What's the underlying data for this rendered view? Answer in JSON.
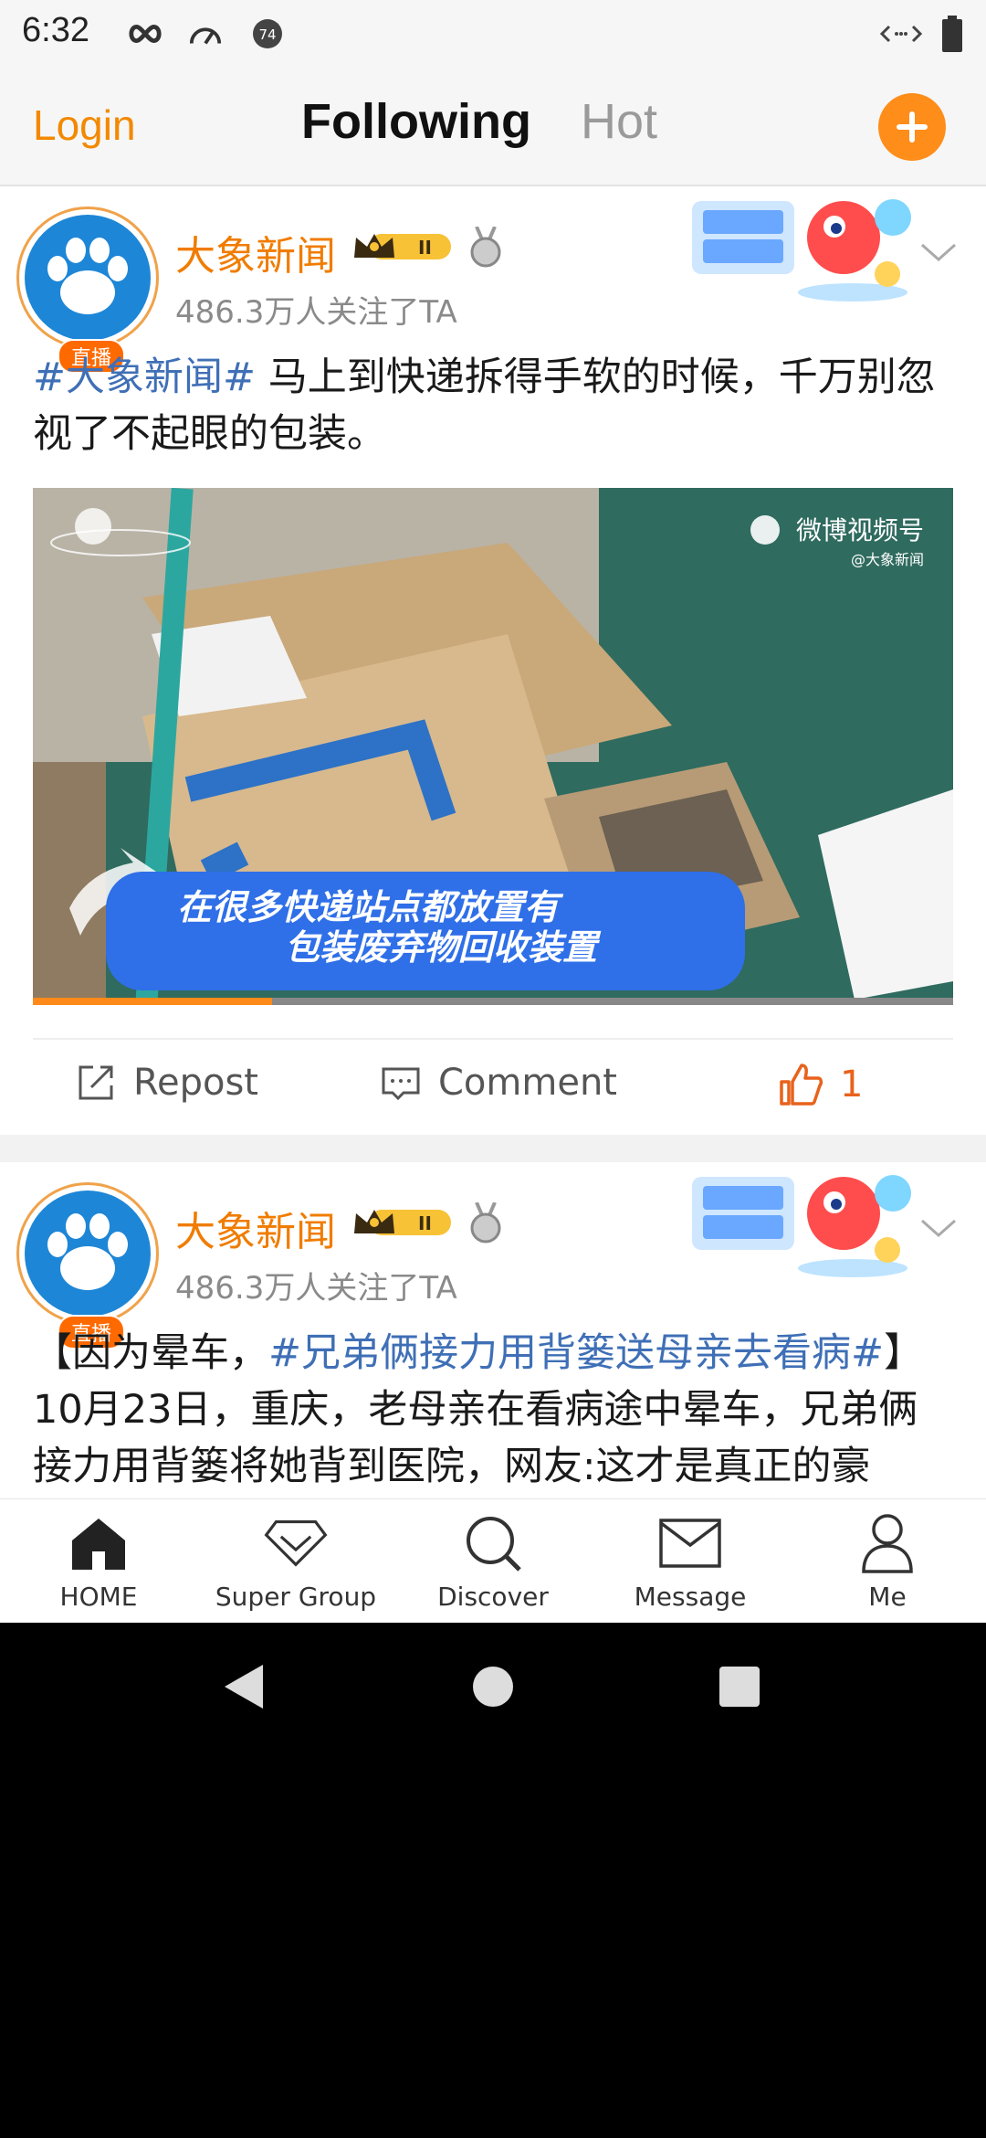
{
  "status_bar": {
    "time": "6:32",
    "icons": [
      "infinity-icon",
      "speedometer-icon",
      "notification-74-icon",
      "code-arrows-icon",
      "battery-icon"
    ],
    "notification_count": "74"
  },
  "top_nav": {
    "login_label": "Login",
    "tabs": [
      {
        "label": "Following",
        "active": true
      },
      {
        "label": "Hot",
        "active": false
      }
    ],
    "accent_color": "#ff8d1a"
  },
  "posts": [
    {
      "username": "大象新闻",
      "live_badge": "直播",
      "followers": "486.3万人关注了TA",
      "vip_level": "II",
      "text_tag": "#大象新闻#",
      "text_body": " 马上到快递拆得手软的时候，千万别忽视了不起眼的包装。",
      "media": {
        "watermark": "微博视频号",
        "watermark_handle": "@大象新闻",
        "caption_line1": "在很多快递站点都放置有",
        "caption_line2": "包装废弃物回收装置",
        "progress": 0.26
      },
      "actions": {
        "repost_label": "Repost",
        "comment_label": "Comment",
        "like_count": "1"
      }
    },
    {
      "username": "大象新闻",
      "live_badge": "直播",
      "followers": "486.3万人关注了TA",
      "vip_level": "II",
      "text_prefix": "【因为晕车，",
      "text_tag": "#兄弟俩接力用背篓送母亲去看病#",
      "text_suffix": "】10月23日，重庆，老母亲在看病途中晕车，兄弟俩接力用背篓将她背到医院，网友:这才是真正的豪"
    }
  ],
  "bottom_nav": [
    {
      "label": "HOME",
      "icon": "home-icon"
    },
    {
      "label": "Super Group",
      "icon": "diamond-icon"
    },
    {
      "label": "Discover",
      "icon": "search-icon"
    },
    {
      "label": "Message",
      "icon": "envelope-icon"
    },
    {
      "label": "Me",
      "icon": "person-icon"
    }
  ]
}
